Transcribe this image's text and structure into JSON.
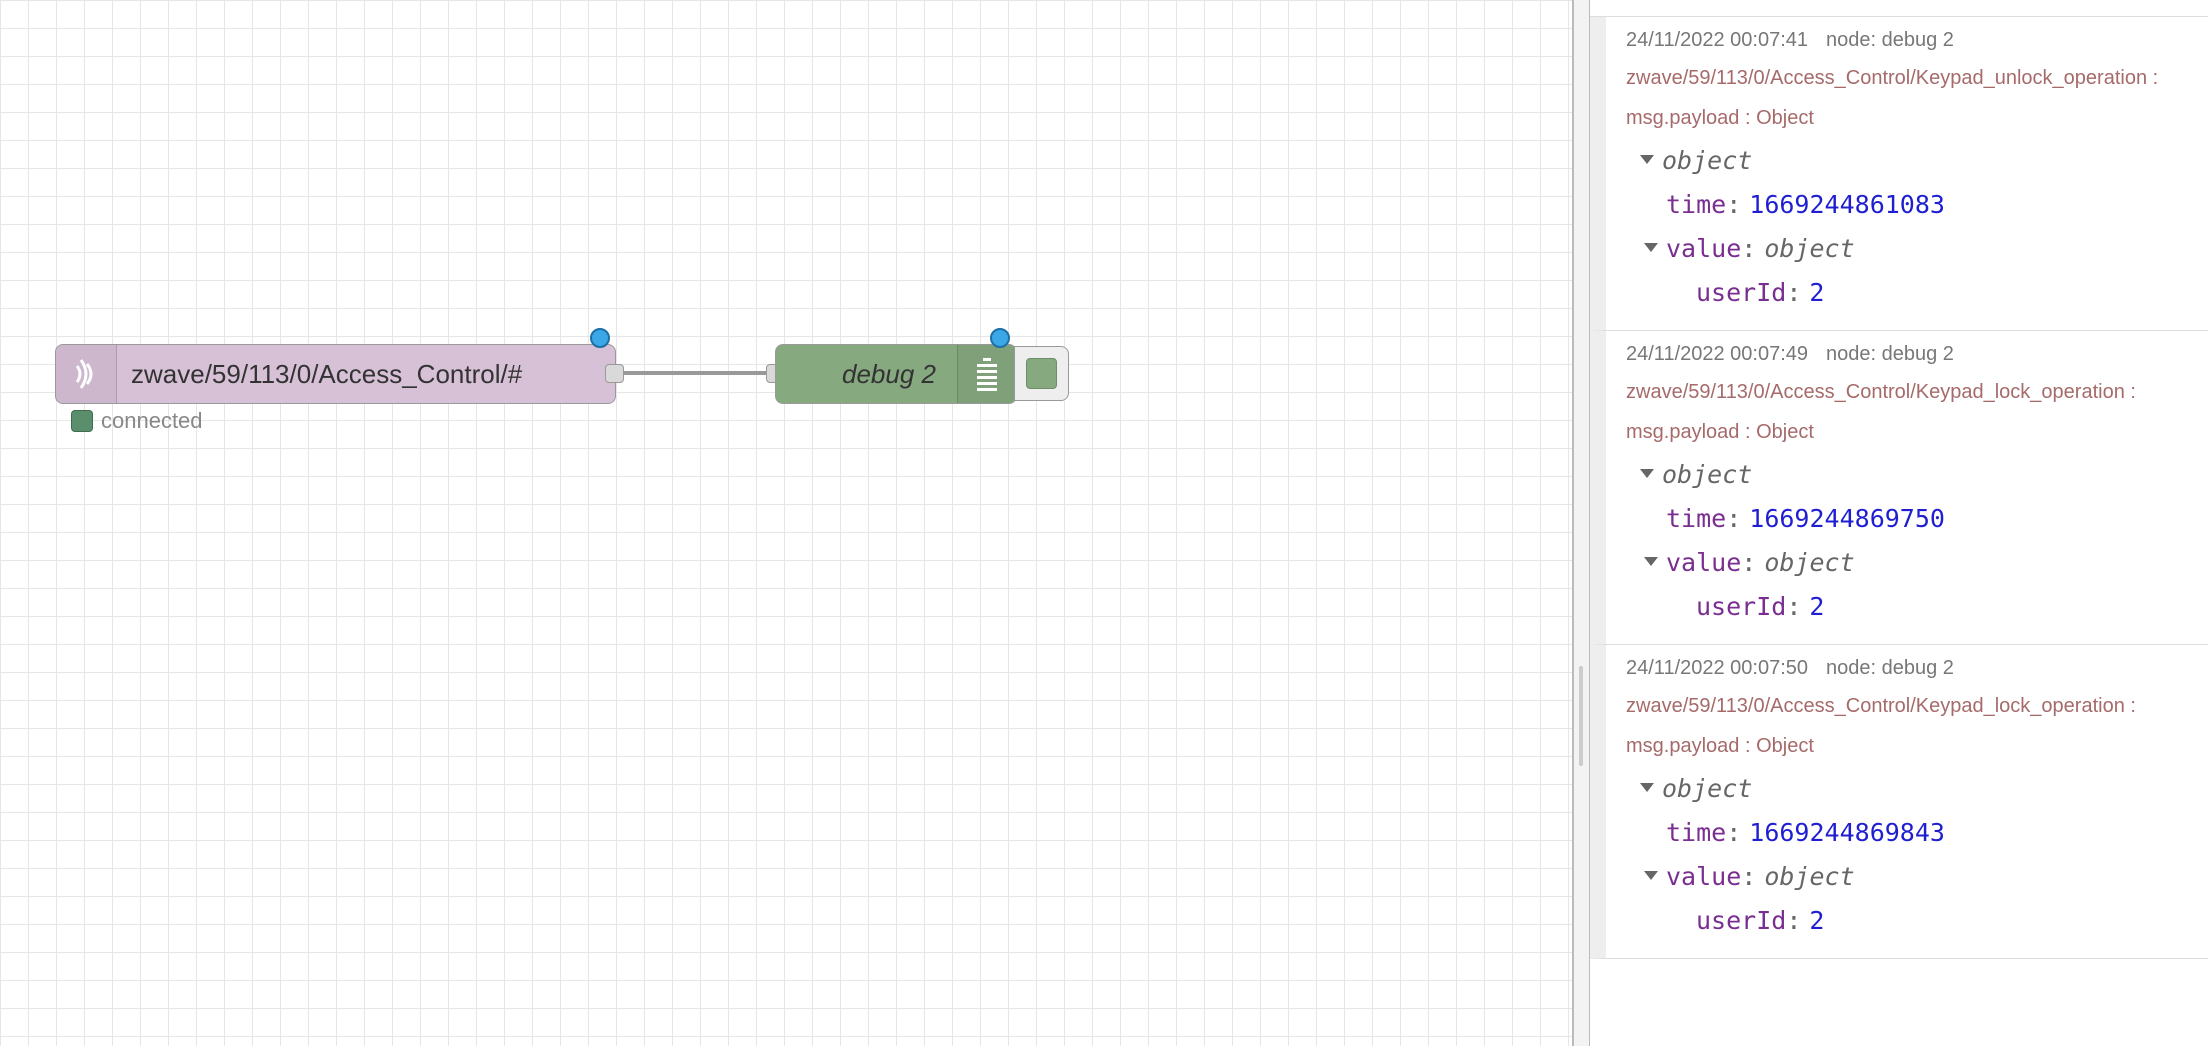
{
  "workspace": {
    "mqtt_node": {
      "label": "zwave/59/113/0/Access_Control/#",
      "color": "#d7c1d7",
      "icon": "bridge-icon",
      "status_text": "connected",
      "status_color": "#5a8e6c"
    },
    "debug_node": {
      "label": "debug 2",
      "color": "#87a980",
      "icon": "debug-list-icon"
    },
    "changed_indicator_color": "#3ba7e6"
  },
  "sidebar": {
    "messages": [
      {
        "timestamp": "24/11/2022 00:07:41",
        "node": "node: debug 2",
        "topic": "zwave/59/113/0/Access_Control/Keypad_unlock_operation : msg.payload : Object",
        "root_type": "object",
        "time_key": "time",
        "time_value": "1669244861083",
        "value_key": "value",
        "value_type": "object",
        "userid_key": "userId",
        "userid_value": "2"
      },
      {
        "timestamp": "24/11/2022 00:07:49",
        "node": "node: debug 2",
        "topic": "zwave/59/113/0/Access_Control/Keypad_lock_operation : msg.payload : Object",
        "root_type": "object",
        "time_key": "time",
        "time_value": "1669244869750",
        "value_key": "value",
        "value_type": "object",
        "userid_key": "userId",
        "userid_value": "2"
      },
      {
        "timestamp": "24/11/2022 00:07:50",
        "node": "node: debug 2",
        "topic": "zwave/59/113/0/Access_Control/Keypad_lock_operation : msg.payload : Object",
        "root_type": "object",
        "time_key": "time",
        "time_value": "1669244869843",
        "value_key": "value",
        "value_type": "object",
        "userid_key": "userId",
        "userid_value": "2"
      }
    ]
  }
}
